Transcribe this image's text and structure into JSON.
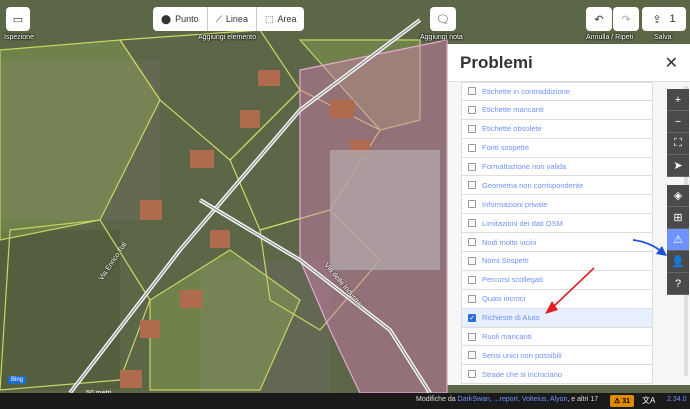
{
  "toolbar": {
    "inspect_label": "Ispezione",
    "add_point": "Punto",
    "add_line": "Linea",
    "add_area": "Area",
    "add_element_label": "Aggiungi elemento",
    "add_note_label": "Aggiungi nota",
    "undo_redo_label": "Annulla / Ripeti",
    "save_count": "1",
    "save_label": "Salva"
  },
  "panel": {
    "title": "Problemi",
    "items": [
      {
        "label": "Etichette in contraddizione",
        "checked": false
      },
      {
        "label": "Etichette mancanti",
        "checked": false
      },
      {
        "label": "Etichette obsolete",
        "checked": false
      },
      {
        "label": "Fonti sospette",
        "checked": false
      },
      {
        "label": "Formattazione non valida",
        "checked": false
      },
      {
        "label": "Geometria non corrispondente",
        "checked": false
      },
      {
        "label": "Informazioni private",
        "checked": false
      },
      {
        "label": "Limitazioni dei dati OSM",
        "checked": false
      },
      {
        "label": "Nodi molto vicini",
        "checked": false
      },
      {
        "label": "Nomi Sospetti",
        "checked": false
      },
      {
        "label": "Percorsi scollegati",
        "checked": false
      },
      {
        "label": "Quasi incroci",
        "checked": false
      },
      {
        "label": "Richieste di Aiuto",
        "checked": true
      },
      {
        "label": "Ruoli mancanti",
        "checked": false
      },
      {
        "label": "Sensi unici non possibili",
        "checked": false
      },
      {
        "label": "Strade che si incrociano",
        "checked": false
      }
    ]
  },
  "map": {
    "road1": "Via Enrico Toti",
    "road2": "Via delle Industrie",
    "scale_label": "50 metri",
    "imagery_badge": "Bing"
  },
  "footer": {
    "attribution_prefix": "Modifiche da ",
    "attribution_users": "DarkSwan, ...report, Volteius, Alyon",
    "attribution_suffix": ", e altri 17",
    "warning_count": "31",
    "version": "2.34.0"
  },
  "colors": {
    "accent": "#7092ff",
    "warning": "#e08a00",
    "annotation_red": "#e02020",
    "annotation_blue": "#1a4fd6"
  }
}
